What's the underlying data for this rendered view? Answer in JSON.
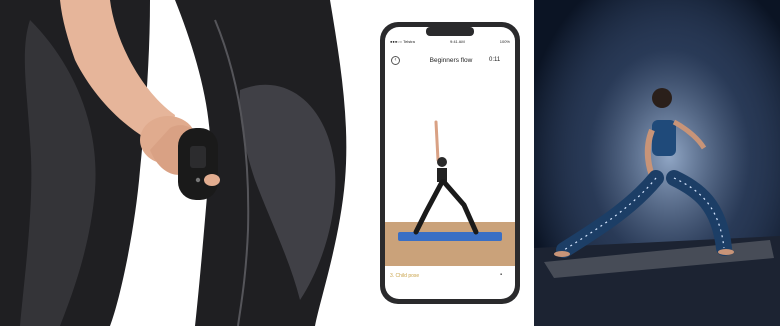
{
  "phone": {
    "status_carrier": "●●●○○ Telstra",
    "status_time": "9:41 AM",
    "status_battery": "100%",
    "screen_title": "Beginners flow",
    "timer": "0:11",
    "pose_label": "3. Child pose",
    "back_icon": "back-circle-icon",
    "menu_icon": "menu-dots-icon"
  },
  "colors": {
    "leggings": "#1f1f22",
    "mesh": "#3a3a3e",
    "skin": "#e6b59a",
    "device": "#1a1a1a",
    "phone_frame": "#2a2a2c",
    "mat_blue": "#3a6fc4",
    "floor_wood": "#caa27a",
    "night_bg": "#101c2e",
    "glow": "#9fb6d6",
    "pose_label": "#c9a34a"
  }
}
